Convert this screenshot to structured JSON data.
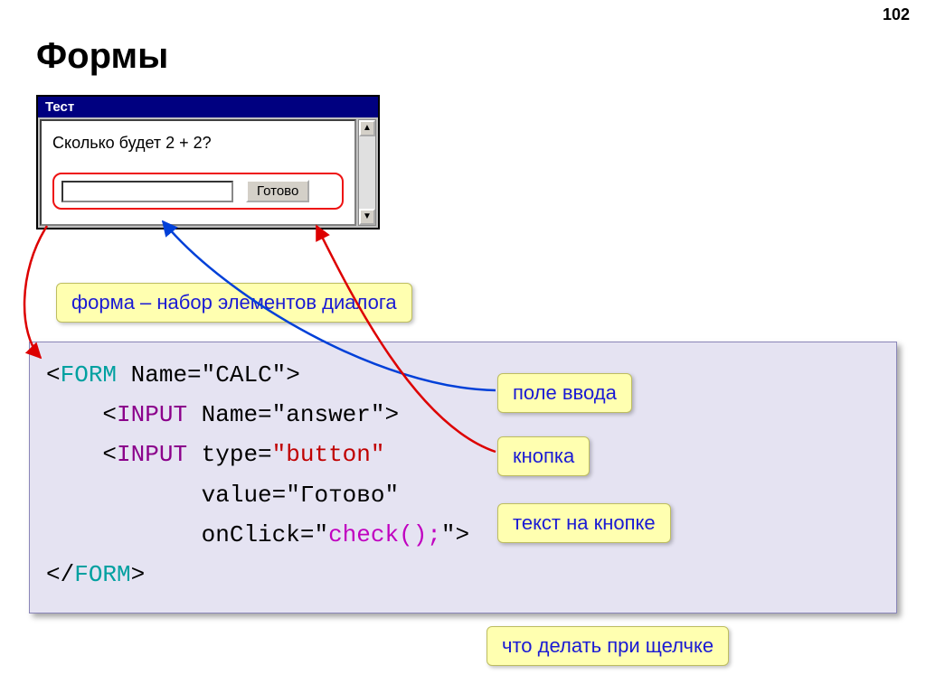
{
  "page_number": "102",
  "heading": "Формы",
  "window": {
    "title": "Тест",
    "question": "Сколько будет 2 + 2?",
    "button_label": "Готово"
  },
  "callouts": {
    "form": "форма – набор элементов диалога",
    "input": "поле ввода",
    "button": "кнопка",
    "button_text": "текст на кнопке",
    "onclick": "что делать при щелчке"
  },
  "code": {
    "open_angle": "<",
    "close_angle": ">",
    "close_slash_angle": "</",
    "form": "FORM",
    "input": "INPUT",
    "name_attr": " Name=",
    "type_attr": " type=",
    "value_attr": "value=",
    "onclick_attr": "onClick=",
    "form_name": "\"CALC\"",
    "answer_name": "\"answer\"",
    "button_type": "\"button\"",
    "ready_val": "\"Готово\"",
    "check_q": "\"",
    "check_fn": "check();",
    "close_q_angle": "\">"
  }
}
